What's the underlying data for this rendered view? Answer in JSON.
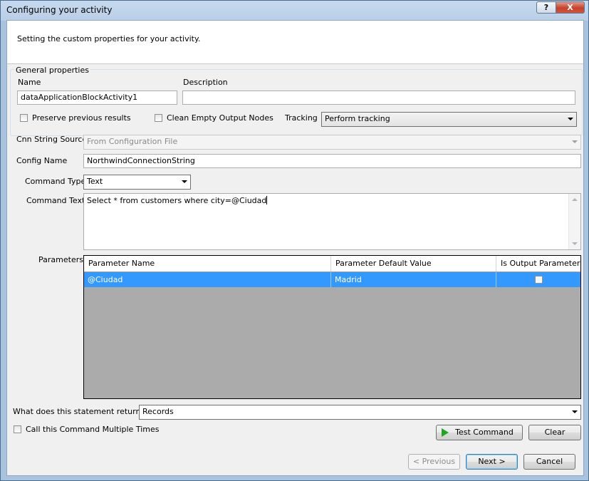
{
  "window": {
    "title": "Configuring your activity",
    "help_label": "?",
    "close_label": "X"
  },
  "header": {
    "text": "Setting the custom properties for your activity."
  },
  "general": {
    "legend": "General properties",
    "name_label": "Name",
    "name_value": "dataApplicationBlockActivity1",
    "description_label": "Description",
    "description_value": "",
    "preserve_label": "Preserve previous results",
    "preserve_checked": false,
    "clean_label": "Clean Empty Output Nodes",
    "clean_checked": false,
    "tracking_label": "Tracking",
    "tracking_value": "Perform tracking"
  },
  "connection": {
    "cnn_label": "Cnn String Source",
    "cnn_value": "From Configuration File",
    "config_label": "Config Name",
    "config_value": "NorthwindConnectionString",
    "cmdtype_label": "Command Type",
    "cmdtype_value": "Text",
    "cmdtext_label": "Command Text",
    "cmdtext_value": "Select * from customers where city=@Ciudad"
  },
  "parameters": {
    "label": "Parameters",
    "columns": [
      "Parameter Name",
      "Parameter Default Value",
      "Is Output Parameter"
    ],
    "rows": [
      {
        "name": "@Ciudad",
        "default": "Madrid",
        "is_output": false
      }
    ]
  },
  "returns": {
    "label": "What does this statement returns?",
    "value": "Records"
  },
  "multiple": {
    "label": "Call this Command Multiple Times",
    "checked": false
  },
  "buttons": {
    "test": "Test Command",
    "clear": "Clear",
    "previous": "< Previous",
    "next": "Next >",
    "cancel": "Cancel"
  },
  "colors": {
    "selection": "#3399ff",
    "grid_empty": "#ababab",
    "title_bar": "#b9cfe7",
    "play_icon": "#1fa51f"
  }
}
